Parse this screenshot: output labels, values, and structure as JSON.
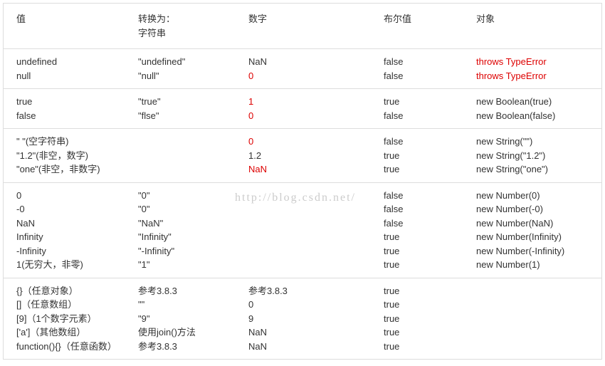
{
  "watermark": "http://blog.csdn.net/",
  "header": {
    "value": "值",
    "convert_to": "转换为：",
    "string": "字符串",
    "number": "数字",
    "boolean": "布尔值",
    "object": "对象"
  },
  "sections": [
    {
      "rows": [
        {
          "v": "undefined",
          "s": "\"undefined\"",
          "n": "NaN",
          "nClass": "",
          "b": "false",
          "o": "throws TypeError",
          "oClass": "red"
        },
        {
          "v": "null",
          "s": "\"null\"",
          "n": "0",
          "nClass": "red",
          "b": "false",
          "o": "throws TypeError",
          "oClass": "red"
        }
      ]
    },
    {
      "rows": [
        {
          "v": "true",
          "s": "\"true\"",
          "n": "1",
          "nClass": "red",
          "b": "true",
          "o": "new Boolean(true)",
          "oClass": ""
        },
        {
          "v": "false",
          "s": "\"flse\"",
          "n": "0",
          "nClass": "red",
          "b": "false",
          "o": "new Boolean(false)",
          "oClass": ""
        }
      ]
    },
    {
      "rows": [
        {
          "v": "\" \"(空字符串)",
          "s": "",
          "n": "0",
          "nClass": "red",
          "b": "false",
          "o": "new String(\"\")",
          "oClass": ""
        },
        {
          "v": "\"1.2\"(非空，数字)",
          "s": "",
          "n": "1.2",
          "nClass": "",
          "b": "true",
          "o": "new String(\"1.2\")",
          "oClass": ""
        },
        {
          "v": "\"one\"(非空，非数字)",
          "s": "",
          "n": "NaN",
          "nClass": "red",
          "b": "true",
          "o": "new String(\"one\")",
          "oClass": ""
        }
      ]
    },
    {
      "rows": [
        {
          "v": "0",
          "s": "\"0\"",
          "n": "",
          "nClass": "",
          "b": "false",
          "o": "new Number(0)",
          "oClass": ""
        },
        {
          "v": "-0",
          "s": "\"0\"",
          "n": "",
          "nClass": "",
          "b": "false",
          "o": "new Number(-0)",
          "oClass": ""
        },
        {
          "v": "NaN",
          "s": "\"NaN\"",
          "n": "",
          "nClass": "",
          "b": "false",
          "o": "new Number(NaN)",
          "oClass": ""
        },
        {
          "v": "Infinity",
          "s": "\"Infinity\"",
          "n": "",
          "nClass": "",
          "b": "true",
          "o": "new Number(Infinity)",
          "oClass": ""
        },
        {
          "v": "-Infinity",
          "s": "\"-Infinity\"",
          "n": "",
          "nClass": "",
          "b": "true",
          "o": "new Number(-Infinity)",
          "oClass": ""
        },
        {
          "v": "1(无穷大，非零)",
          "s": "\"1\"",
          "n": "",
          "nClass": "",
          "b": "true",
          "o": "new Number(1)",
          "oClass": ""
        }
      ]
    },
    {
      "rows": [
        {
          "v": "{}（任意对象）",
          "s": "参考3.8.3",
          "n": "参考3.8.3",
          "nClass": "",
          "b": "true",
          "o": "",
          "oClass": ""
        },
        {
          "v": "[]（任意数组）",
          "s": "\"\"",
          "n": "0",
          "nClass": "",
          "b": "true",
          "o": "",
          "oClass": ""
        },
        {
          "v": "[9]（1个数字元素）",
          "s": "\"9\"",
          "n": "9",
          "nClass": "",
          "b": "true",
          "o": "",
          "oClass": ""
        },
        {
          "v": "['a']（其他数组）",
          "s": "使用join()方法",
          "n": "NaN",
          "nClass": "",
          "b": "true",
          "o": "",
          "oClass": ""
        },
        {
          "v": "function(){}（任意函数）",
          "s": "参考3.8.3",
          "n": "NaN",
          "nClass": "",
          "b": "true",
          "o": "",
          "oClass": ""
        }
      ]
    }
  ]
}
